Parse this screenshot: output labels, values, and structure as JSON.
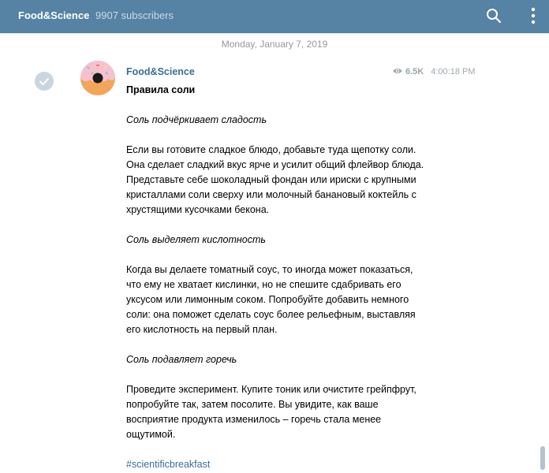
{
  "header": {
    "channel_name": "Food&Science",
    "subscribers": "9907 subscribers"
  },
  "date_separator": "Monday, January 7, 2019",
  "message": {
    "author": "Food&Science",
    "views": "6.5K",
    "time": "4:00:18 PM",
    "title": "Правила соли",
    "sections": [
      {
        "subtitle": "Соль подчёркивает сладость",
        "text": "Если вы готовите сладкое блюдо, добавьте туда щепотку соли. Она сделает сладкий вкус ярче и усилит общий флейвор блюда. Представьте себе шоколадный фондан или ириски с крупными кристаллами соли сверху или молочный банановый коктейль с хрустящими кусочками бекона."
      },
      {
        "subtitle": "Соль выделяет кислотность",
        "text": "Когда вы делаете томатный соус, то иногда может показаться, что ему не хватает кислинки, но не спешите сдабривать его уксусом или лимонным соком. Попробуйте добавить немного соли: она поможет сделать соус более рельефным, выставляя его кислотность на первый план."
      },
      {
        "subtitle": "Соль подавляет горечь",
        "text": "Проведите эксперимент. Купите тоник или очистите грейпфрут, попробуйте так, затем посолите. Вы увидите, как ваше восприятие продукта изменилось – горечь стала менее ощутимой."
      }
    ],
    "hashtag": "#scientificbreakfast"
  },
  "icons": {
    "search": "search-icon",
    "more": "more-vertical-icon",
    "check": "check-icon",
    "eye": "eye-icon",
    "avatar": "donut-avatar"
  },
  "colors": {
    "header_bg": "#5682a3",
    "link": "#3a6d99",
    "meta": "#a0a8ae"
  }
}
